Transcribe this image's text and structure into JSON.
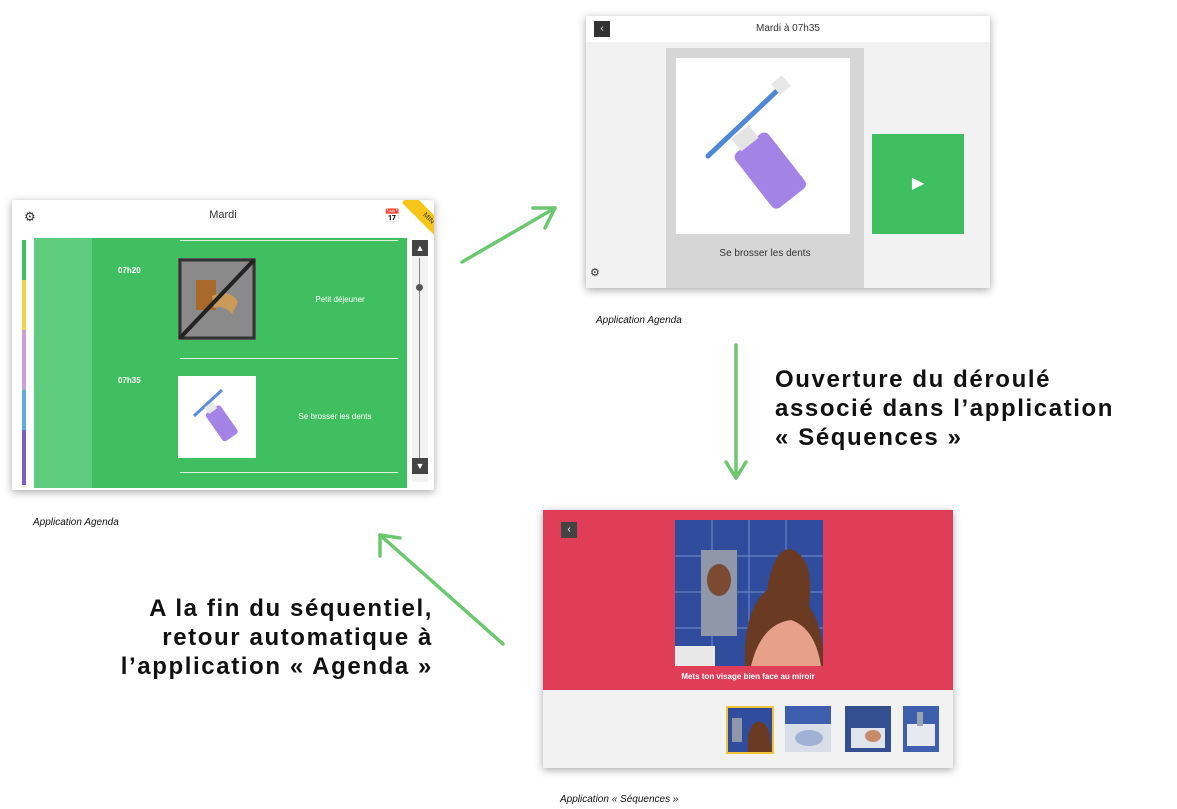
{
  "agenda_screen": {
    "title": "Mardi",
    "ribbon": "MIN",
    "events": [
      {
        "time": "07h20",
        "label": "Petit déjeuner"
      },
      {
        "time": "07h35",
        "label": "Se brosser les dents"
      }
    ],
    "caption": "Application Agenda"
  },
  "detail_screen": {
    "title": "Mardi à 07h35",
    "activity": "Se brosser les dents",
    "caption": "Application Agenda"
  },
  "sequences_screen": {
    "step_text": "Mets ton visage bien face au miroir",
    "caption": "Application « Séquences »"
  },
  "annotations": {
    "open": "Ouverture du déroulé\nassocié dans l’application\n« Séquences »",
    "return": "A la fin du séquentiel,\nretour automatique à\nl’application « Agenda »"
  },
  "colors": {
    "agenda_green": "#3fbf5f",
    "sequences_red": "#e03d58",
    "arrow_green": "#6cc86f"
  }
}
